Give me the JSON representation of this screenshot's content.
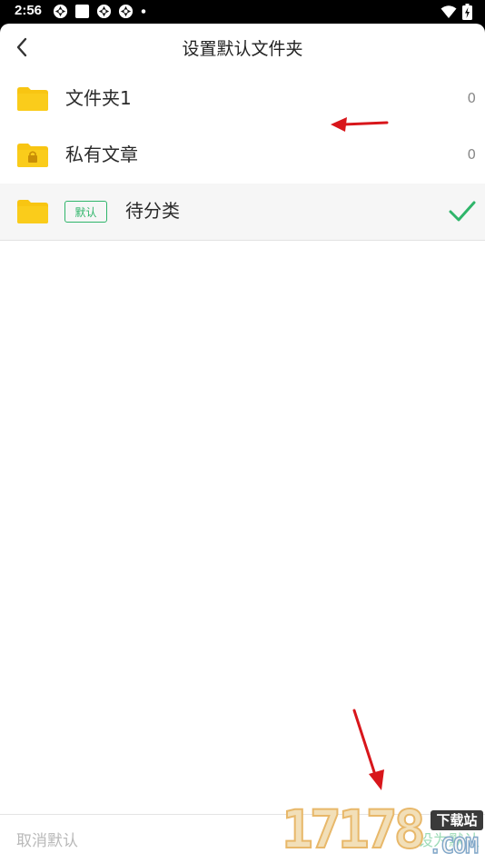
{
  "status_bar": {
    "time": "2:56",
    "icons": [
      "aperture-icon",
      "square-icon",
      "aperture-icon",
      "aperture-icon",
      "dot-icon"
    ],
    "right_icons": [
      "wifi-icon",
      "battery-charging-icon"
    ]
  },
  "nav": {
    "title": "设置默认文件夹",
    "back_icon": "chevron-left-icon"
  },
  "folders": [
    {
      "name": "文件夹1",
      "count": "0",
      "locked": false,
      "is_default": false,
      "selected": false
    },
    {
      "name": "私有文章",
      "count": "0",
      "locked": true,
      "is_default": false,
      "selected": false
    },
    {
      "name": "待分类",
      "count": "",
      "locked": false,
      "is_default": true,
      "selected": true,
      "tag": "默认"
    }
  ],
  "bottom_bar": {
    "cancel_default": "取消默认",
    "set_default": "设为默认"
  },
  "watermark": {
    "number": "17178",
    "site": "下载站",
    "domain": ".COM"
  },
  "colors": {
    "folder": "#F8C512",
    "accent_green": "#2FB56A",
    "annotation_red": "#D8161B"
  }
}
